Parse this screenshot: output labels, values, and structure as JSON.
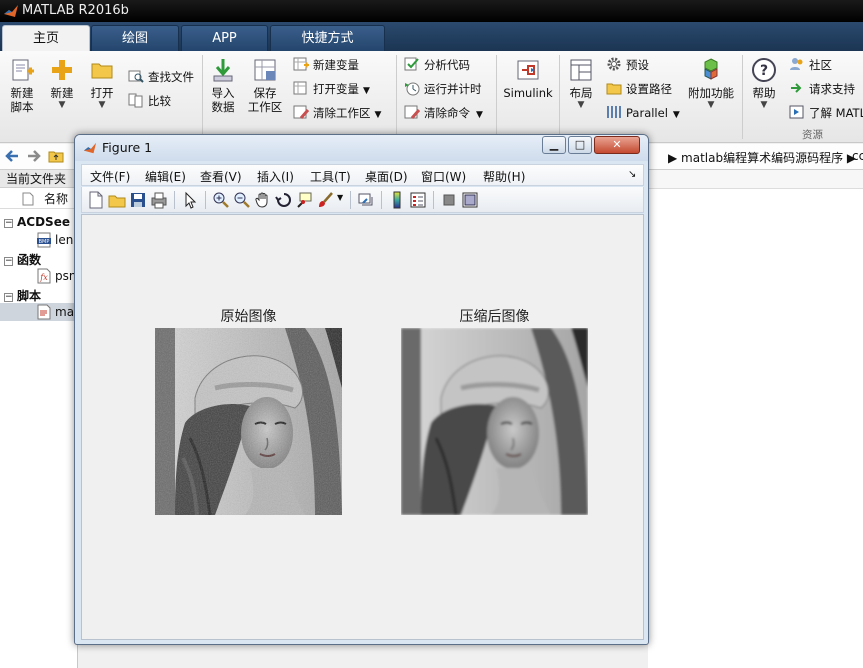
{
  "app": {
    "title": "MATLAB R2016b"
  },
  "ribbon_tabs": [
    {
      "label": "主页",
      "active": true
    },
    {
      "label": "绘图",
      "active": false
    },
    {
      "label": "APP",
      "active": false
    },
    {
      "label": "快捷方式",
      "active": false
    }
  ],
  "ribbon": {
    "new_script": "新建\n脚本",
    "new": "新建",
    "open": "打开",
    "find_files": "查找文件",
    "compare": "比较",
    "import_data": "导入\n数据",
    "save_workspace": "保存\n工作区",
    "new_variable": "新建变量",
    "open_variable": "打开变量",
    "clear_workspace": "清除工作区",
    "analyze_code": "分析代码",
    "run_and_time": "运行并计时",
    "clear_commands": "清除命令",
    "simulink": "Simulink",
    "layout": "布局",
    "preferences": "预设",
    "set_path": "设置路径",
    "parallel": "Parallel",
    "addons": "附加功能",
    "help": "帮助",
    "community": "社区",
    "request_support": "请求支持",
    "learn_matlab": "了解 MATL",
    "group_resources": "资源"
  },
  "path": {
    "crumb": "matlab编程算术编码源码程序",
    "crumb_more": "cc"
  },
  "current_folder": {
    "title": "当前文件夹",
    "column_name": "名称",
    "groups": [
      {
        "label": "ACDSee I",
        "items": [
          {
            "name": "len",
            "icon": "bmp-file-icon"
          }
        ]
      },
      {
        "label": "函数",
        "items": [
          {
            "name": "psn",
            "icon": "function-file-icon"
          }
        ]
      },
      {
        "label": "脚本",
        "items": [
          {
            "name": "mal",
            "icon": "script-file-icon"
          }
        ]
      }
    ]
  },
  "figure": {
    "title": "Figure 1",
    "menus": [
      "文件(F)",
      "编辑(E)",
      "查看(V)",
      "插入(I)",
      "工具(T)",
      "桌面(D)",
      "窗口(W)",
      "帮助(H)"
    ],
    "dock_arrow": "↘",
    "toolbar_icons": [
      "new-figure-icon",
      "open-file-icon",
      "save-icon",
      "print-icon",
      "pointer-icon",
      "zoom-in-icon",
      "zoom-out-icon",
      "pan-icon",
      "rotate-3d-icon",
      "data-cursor-icon",
      "brush-icon",
      "link-plot-icon",
      "colorbar-icon",
      "legend-icon",
      "hide-plot-tools-icon",
      "show-plot-tools-icon"
    ],
    "axes": [
      {
        "title": "原始图像"
      },
      {
        "title": "压缩后图像"
      }
    ]
  },
  "colors": {
    "ribbon_tab_bg": "#24466d",
    "figure_bg": "#f0f0f0",
    "close_button": "#c44a30"
  }
}
